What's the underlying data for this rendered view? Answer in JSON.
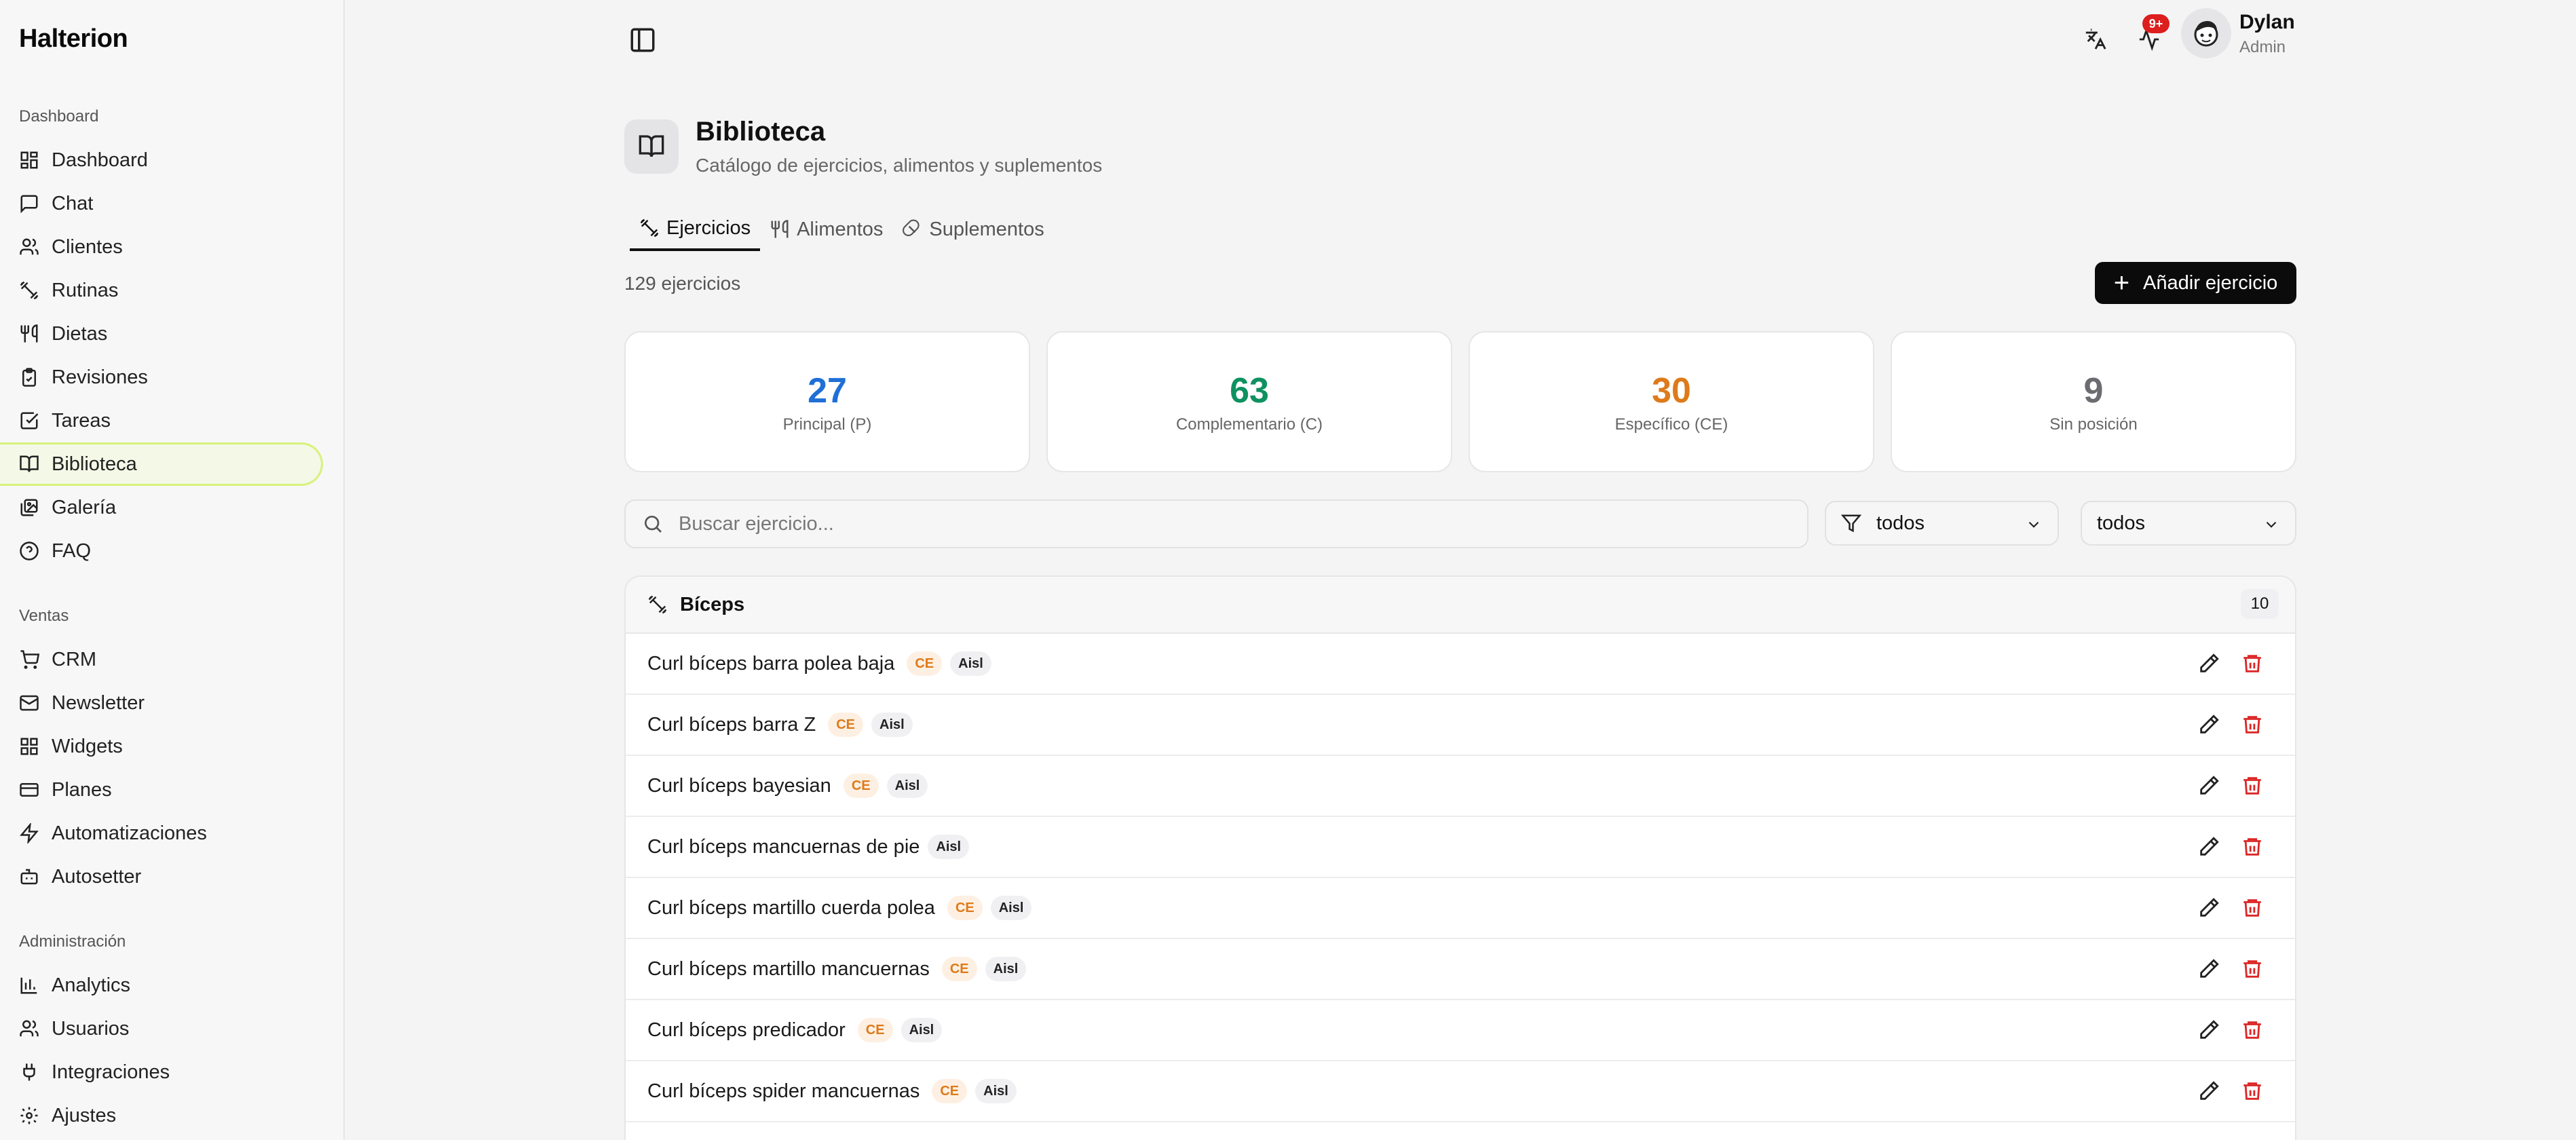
{
  "app": {
    "brand": "Halterion"
  },
  "sidebar": {
    "sections": [
      {
        "heading": "Dashboard",
        "items": [
          {
            "label": "Dashboard",
            "icon": "layout-dashboard-icon"
          },
          {
            "label": "Chat",
            "icon": "chat-icon"
          },
          {
            "label": "Clientes",
            "icon": "users-icon"
          },
          {
            "label": "Rutinas",
            "icon": "dumbbell-icon"
          },
          {
            "label": "Dietas",
            "icon": "utensils-icon"
          },
          {
            "label": "Revisiones",
            "icon": "clipboard-check-icon"
          },
          {
            "label": "Tareas",
            "icon": "square-check-icon"
          },
          {
            "label": "Biblioteca",
            "icon": "book-open-icon",
            "active": true
          },
          {
            "label": "Galería",
            "icon": "images-icon"
          },
          {
            "label": "FAQ",
            "icon": "help-circle-icon"
          }
        ]
      },
      {
        "heading": "Ventas",
        "items": [
          {
            "label": "CRM",
            "icon": "cart-icon"
          },
          {
            "label": "Newsletter",
            "icon": "mail-icon"
          },
          {
            "label": "Widgets",
            "icon": "grid-icon"
          },
          {
            "label": "Planes",
            "icon": "credit-card-icon"
          },
          {
            "label": "Automatizaciones",
            "icon": "zap-icon"
          },
          {
            "label": "Autosetter",
            "icon": "bot-icon"
          }
        ]
      },
      {
        "heading": "Administración",
        "items": [
          {
            "label": "Analytics",
            "icon": "bar-chart-icon"
          },
          {
            "label": "Usuarios",
            "icon": "users-icon"
          },
          {
            "label": "Integraciones",
            "icon": "plug-icon"
          },
          {
            "label": "Ajustes",
            "icon": "gear-icon"
          }
        ]
      }
    ]
  },
  "header": {
    "notification_count": "9+",
    "user": {
      "name": "Dylan",
      "role": "Admin"
    }
  },
  "page": {
    "title": "Biblioteca",
    "subtitle": "Catálogo de ejercicios, alimentos y suplementos",
    "tabs": [
      {
        "label": "Ejercicios",
        "icon": "dumbbell-icon",
        "active": true
      },
      {
        "label": "Alimentos",
        "icon": "utensils-icon"
      },
      {
        "label": "Suplementos",
        "icon": "pill-icon"
      }
    ],
    "count_text": "129 ejercicios",
    "add_button": "Añadir ejercicio"
  },
  "stats": [
    {
      "value": "27",
      "label": "Principal (P)",
      "color": "#1f6fd6"
    },
    {
      "value": "63",
      "label": "Complementario (C)",
      "color": "#0f9160"
    },
    {
      "value": "30",
      "label": "Específico (CE)",
      "color": "#de7a1a"
    },
    {
      "value": "9",
      "label": "Sin posición",
      "color": "#6b6b70"
    }
  ],
  "filters": {
    "search_placeholder": "Buscar ejercicio...",
    "select1": "todos",
    "select2": "todos"
  },
  "group": {
    "name": "Bíceps",
    "count": "10",
    "rows": [
      {
        "name": "Curl bíceps barra polea baja",
        "tags": [
          "CE",
          "Aisl"
        ]
      },
      {
        "name": "Curl bíceps barra Z",
        "tags": [
          "CE",
          "Aisl"
        ]
      },
      {
        "name": "Curl bíceps bayesian",
        "tags": [
          "CE",
          "Aisl"
        ]
      },
      {
        "name": "Curl bíceps mancuernas de pie",
        "tags": [
          "Aisl"
        ]
      },
      {
        "name": "Curl bíceps martillo cuerda polea",
        "tags": [
          "CE",
          "Aisl"
        ]
      },
      {
        "name": "Curl bíceps martillo mancuernas",
        "tags": [
          "CE",
          "Aisl"
        ]
      },
      {
        "name": "Curl bíceps predicador",
        "tags": [
          "CE",
          "Aisl"
        ]
      },
      {
        "name": "Curl bíceps spider mancuernas",
        "tags": [
          "CE",
          "Aisl"
        ]
      }
    ]
  }
}
